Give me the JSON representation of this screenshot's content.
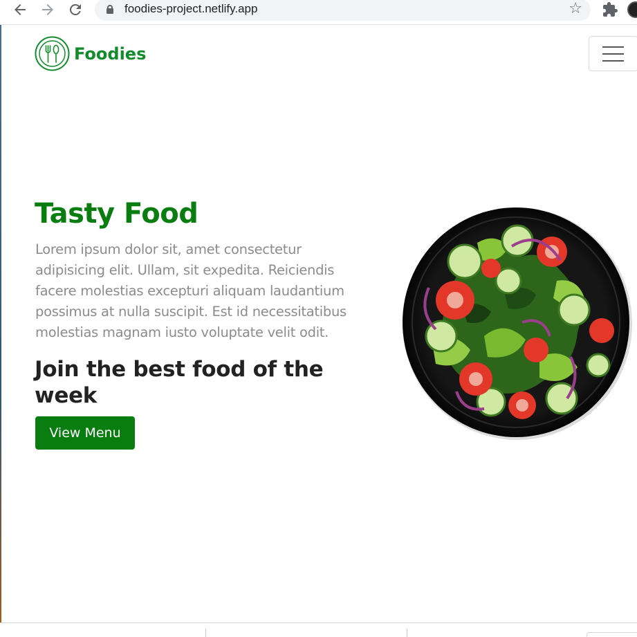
{
  "browser": {
    "url": "foodies-project.netlify.app",
    "back_icon": "arrow-left-icon",
    "forward_icon": "arrow-right-icon",
    "reload_icon": "reload-icon",
    "bookmark_icon": "star-icon",
    "extensions_icon": "puzzle-icon"
  },
  "nav": {
    "brand_name": "Foodies",
    "brand_logo_icon": "fork-spoon-icon",
    "menu_icon": "hamburger-icon"
  },
  "hero": {
    "title": "Tasty Food",
    "description": "Lorem ipsum dolor sit, amet consectetur adipisicing elit. Ullam, sit expedita. Reiciendis facere molestias excepturi aliquam laudantium possimus at nulla suscipit. Est id necessitatibus molestias magnam iusto voluptate velit odit.",
    "subtitle": "Join the best food of the week",
    "cta_label": "View Menu"
  },
  "colors": {
    "brand_green": "#0a7d10",
    "logo_green": "#128c2a",
    "text_gray": "#8c8c8c",
    "heading_dark": "#222222"
  }
}
